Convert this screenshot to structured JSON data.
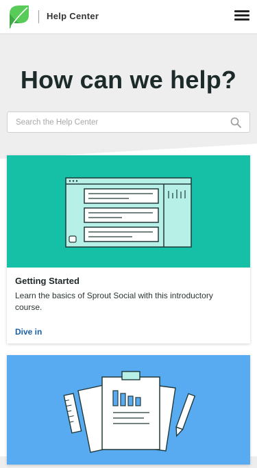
{
  "header": {
    "title": "Help Center",
    "logo_icon": "sprout-leaf-logo",
    "menu_icon": "hamburger-menu-icon"
  },
  "hero": {
    "headline": "How can we help?",
    "search": {
      "placeholder": "Search the Help Center",
      "icon": "search-icon"
    }
  },
  "cards": [
    {
      "title": "Getting Started",
      "description": "Learn the basics of Sprout Social with this introductory course.",
      "link": "Dive in",
      "hero_color": "#15c0a6",
      "illustration": "dashboard-window-illustration"
    },
    {
      "title": "",
      "description": "",
      "link": "",
      "hero_color": "#59abf1",
      "illustration": "clipboard-report-illustration"
    }
  ],
  "colors": {
    "brand_green": "#59cb59",
    "link_blue": "#1a5fa5",
    "teal": "#15c0a6",
    "sky_blue": "#59abf1"
  }
}
